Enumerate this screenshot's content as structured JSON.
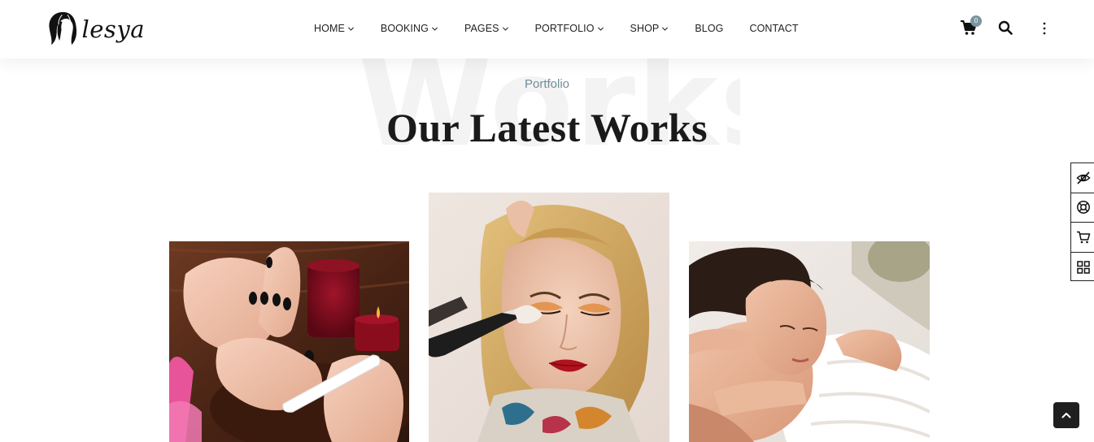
{
  "brand": {
    "name": "lesya"
  },
  "nav": {
    "items": [
      {
        "label": "HOME",
        "has_dropdown": true
      },
      {
        "label": "BOOKING",
        "has_dropdown": true
      },
      {
        "label": "PAGES",
        "has_dropdown": true
      },
      {
        "label": "PORTFOLIO",
        "has_dropdown": true
      },
      {
        "label": "SHOP",
        "has_dropdown": true
      },
      {
        "label": "BLOG",
        "has_dropdown": false
      },
      {
        "label": "CONTACT",
        "has_dropdown": false
      }
    ]
  },
  "header_actions": {
    "cart_count": "0",
    "cart_icon": "cart-icon",
    "search_icon": "search-icon",
    "more_icon": "vertical-dots-icon"
  },
  "section": {
    "watermark": "Works",
    "subtitle": "Portfolio",
    "title": "Our Latest Works"
  },
  "gallery": {
    "items": [
      {
        "subject": "manicure-photo"
      },
      {
        "subject": "makeup-photo"
      },
      {
        "subject": "massage-photo"
      }
    ]
  },
  "side_tools": {
    "items": [
      "eye-slash-icon",
      "lifebuoy-icon",
      "cart-icon",
      "grid-icon"
    ]
  },
  "colors": {
    "accent": "#6f8d99",
    "badge": "#7a95a0",
    "text": "#222222",
    "watermark": "#f3f3f3",
    "to_top_bg": "#1f1f1f"
  }
}
